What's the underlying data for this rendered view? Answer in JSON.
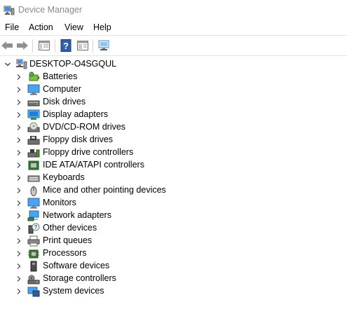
{
  "window": {
    "title": "Device Manager"
  },
  "menu": [
    {
      "label": "File"
    },
    {
      "label": "Action"
    },
    {
      "label": "View"
    },
    {
      "label": "Help"
    }
  ],
  "toolbar": {
    "buttons": [
      {
        "icon": "back-arrow-icon"
      },
      {
        "icon": "forward-arrow-icon"
      },
      {
        "icon": "properties-icon"
      },
      {
        "icon": "help-icon"
      },
      {
        "icon": "update-driver-icon"
      },
      {
        "icon": "scan-hardware-icon"
      }
    ]
  },
  "tree": {
    "root": {
      "label": "DESKTOP-O4SGQUL",
      "icon": "computer-tree-icon",
      "expanded": true
    },
    "categories": [
      {
        "label": "Batteries",
        "icon": "battery-icon"
      },
      {
        "label": "Computer",
        "icon": "computer-icon"
      },
      {
        "label": "Disk drives",
        "icon": "disk-drive-icon"
      },
      {
        "label": "Display adapters",
        "icon": "display-adapter-icon"
      },
      {
        "label": "DVD/CD-ROM drives",
        "icon": "dvd-drive-icon"
      },
      {
        "label": "Floppy disk drives",
        "icon": "floppy-disk-icon"
      },
      {
        "label": "Floppy drive controllers",
        "icon": "floppy-controller-icon"
      },
      {
        "label": "IDE ATA/ATAPI controllers",
        "icon": "ide-controller-icon"
      },
      {
        "label": "Keyboards",
        "icon": "keyboard-icon"
      },
      {
        "label": "Mice and other pointing devices",
        "icon": "mouse-icon"
      },
      {
        "label": "Monitors",
        "icon": "monitor-icon"
      },
      {
        "label": "Network adapters",
        "icon": "network-adapter-icon"
      },
      {
        "label": "Other devices",
        "icon": "unknown-device-icon"
      },
      {
        "label": "Print queues",
        "icon": "printer-icon"
      },
      {
        "label": "Processors",
        "icon": "processor-icon"
      },
      {
        "label": "Software devices",
        "icon": "software-device-icon"
      },
      {
        "label": "Storage controllers",
        "icon": "storage-controller-icon"
      },
      {
        "label": "System devices",
        "icon": "system-device-icon"
      }
    ]
  },
  "colors": {
    "title_gray": "#8a8a8a",
    "accent_blue": "#1e73c8"
  }
}
